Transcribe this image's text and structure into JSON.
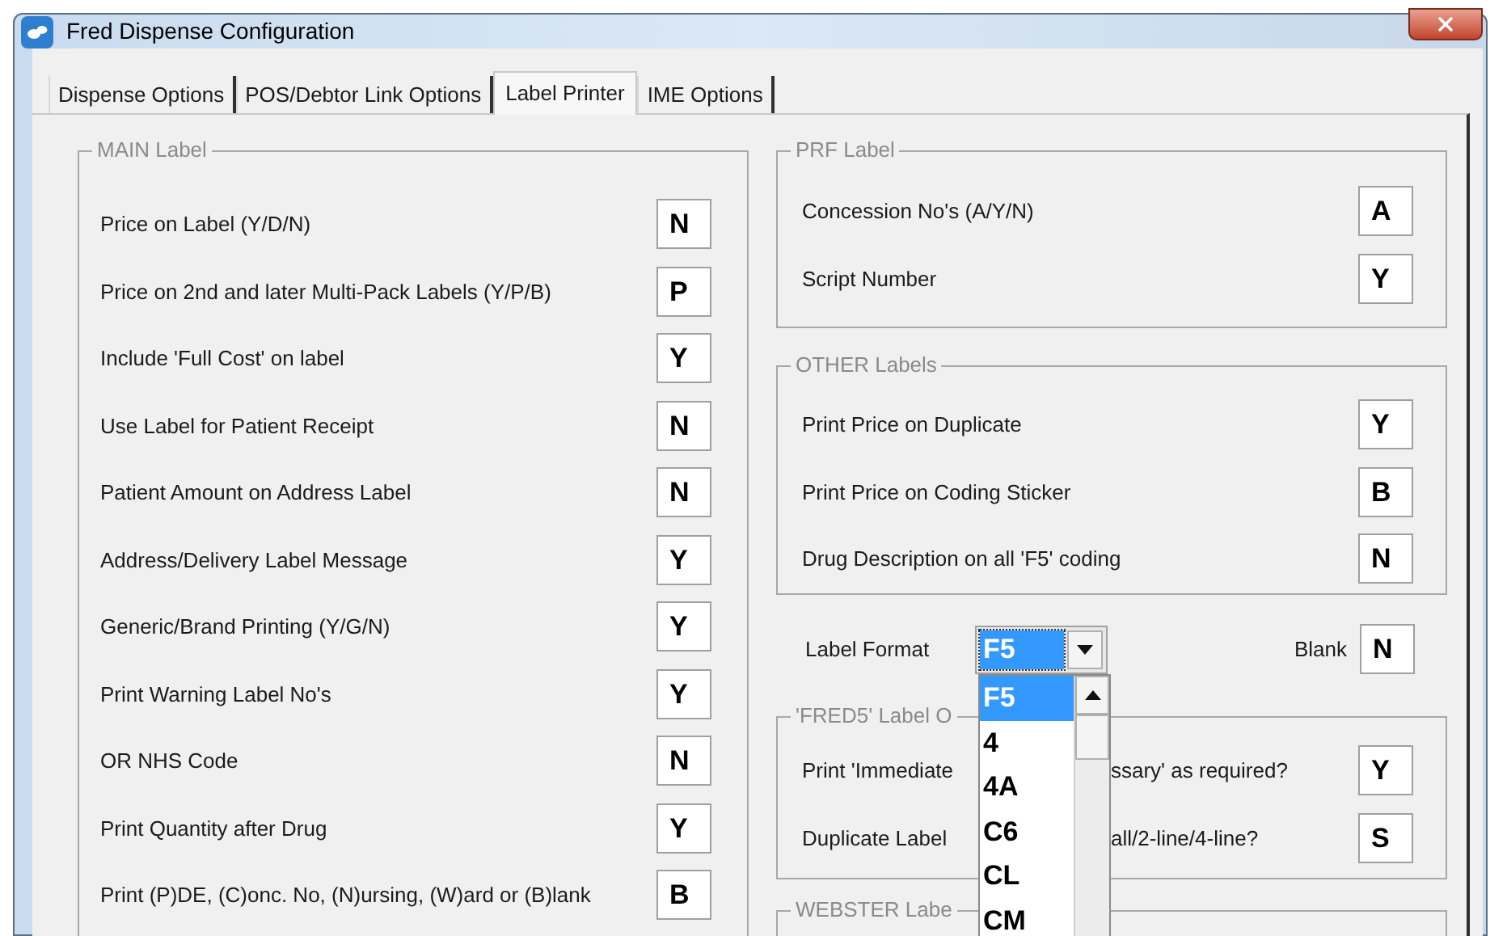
{
  "window": {
    "title": "Fred Dispense Configuration"
  },
  "tabs": [
    {
      "label": "Dispense Options",
      "selected": false
    },
    {
      "label": "POS/Debtor Link Options",
      "selected": false
    },
    {
      "label": "Label Printer",
      "selected": true
    },
    {
      "label": "IME Options",
      "selected": false
    }
  ],
  "main_label": {
    "title": "MAIN Label",
    "rows": [
      {
        "label": "Price on Label (Y/D/N)",
        "value": "N"
      },
      {
        "label": "Price on 2nd and later  Multi-Pack Labels (Y/P/B)",
        "value": "P"
      },
      {
        "label": "Include 'Full Cost' on label",
        "value": "Y"
      },
      {
        "label": "Use Label for Patient Receipt",
        "value": "N"
      },
      {
        "label": "Patient Amount on Address Label",
        "value": "N"
      },
      {
        "label": "Address/Delivery Label Message",
        "value": "Y"
      },
      {
        "label": "Generic/Brand Printing (Y/G/N)",
        "value": "Y"
      },
      {
        "label": "Print Warning Label No's",
        "value": "Y"
      },
      {
        "label": "OR  NHS Code",
        "value": "N"
      },
      {
        "label": "Print Quantity after Drug",
        "value": "Y"
      },
      {
        "label": "Print (P)DE, (C)onc. No, (N)ursing, (W)ard or (B)lank",
        "value": "B"
      }
    ]
  },
  "prf_label": {
    "title": "PRF Label",
    "rows": [
      {
        "label": "Concession No's (A/Y/N)",
        "value": "A"
      },
      {
        "label": "Script Number",
        "value": "Y"
      }
    ]
  },
  "other_labels": {
    "title": "OTHER Labels",
    "rows": [
      {
        "label": "Print Price on Duplicate",
        "value": "Y"
      },
      {
        "label": "Print Price on Coding Sticker",
        "value": "B"
      },
      {
        "label": "Drug Description on all 'F5' coding",
        "value": "N"
      }
    ]
  },
  "label_format": {
    "label": "Label Format",
    "value": "F5",
    "blank_label": "Blank",
    "blank_value": "N"
  },
  "format_dropdown": {
    "items": [
      {
        "label": "F5",
        "selected": true
      },
      {
        "label": "4",
        "selected": false
      },
      {
        "label": "4A",
        "selected": false
      },
      {
        "label": "C6",
        "selected": false
      },
      {
        "label": "CL",
        "selected": false
      },
      {
        "label": "CM",
        "selected": false
      }
    ]
  },
  "fred5_label": {
    "title": "'FRED5' Label O",
    "rows": [
      {
        "label_start": "Print 'Immediate",
        "label_end": "ssary' as required?",
        "value": "Y"
      },
      {
        "label_start": "Duplicate Label",
        "label_end": "all/2-line/4-line?",
        "value": "S"
      }
    ]
  },
  "webster_label": {
    "title": "WEBSTER Labe"
  }
}
